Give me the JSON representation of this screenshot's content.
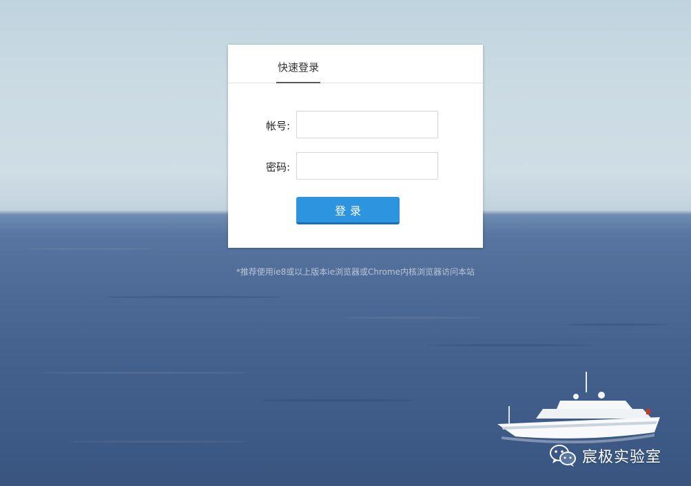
{
  "login": {
    "tab_label": "快速登录",
    "account_label": "帐号:",
    "account_value": "",
    "account_placeholder": "",
    "password_label": "密码:",
    "password_value": "",
    "password_placeholder": "",
    "submit_label": "登录"
  },
  "hint_text": "*推荐使用ie8或以上版本ie浏览器或Chrome内核浏览器访问本站",
  "watermark": {
    "text": "宸极实验室",
    "icon": "wechat-icon"
  },
  "colors": {
    "button": "#2d95e0",
    "tab_underline": "#555555",
    "hint": "#b9c6d6"
  }
}
